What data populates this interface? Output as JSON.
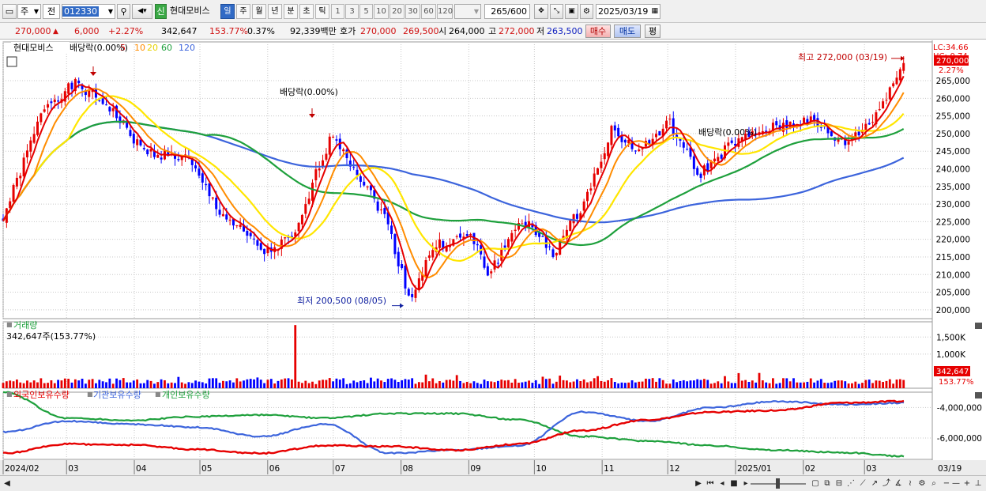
{
  "toolbar": {
    "market": "주",
    "jeon": "전",
    "code": "012330",
    "shin": "신",
    "name": "현대모비스",
    "periods": [
      "일",
      "주",
      "월",
      "년",
      "분",
      "초",
      "틱"
    ],
    "nums": [
      "1",
      "3",
      "5",
      "10",
      "20",
      "30",
      "60",
      "120"
    ],
    "count": "265",
    "count_total": "/600",
    "date": "2025/03/19"
  },
  "quote": {
    "price": "270,000",
    "change": "6,000",
    "change_pct": "+2.27%",
    "volume": "342,647",
    "volume_ratio": "153.77%",
    "turnover": "0.37%",
    "amount": "92,339백만",
    "hoga_label": "호가",
    "ask": "270,000",
    "bid": "269,500",
    "open_label": "시",
    "open": "264,000",
    "high_label": "고",
    "high": "272,000",
    "low_label": "저",
    "low": "263,500",
    "buy": "매수",
    "sell": "매도",
    "eval": "평"
  },
  "colors": {
    "up": "#e60000",
    "down": "#0000ff",
    "ma5": "#e60000",
    "ma10": "#ff8c00",
    "ma20": "#ffe600",
    "ma60": "#1ea03c",
    "ma120": "#3c64dc",
    "foreign": "#e60000",
    "inst": "#3c64dc",
    "indiv": "#1ea03c",
    "bg": "#ffffff",
    "grid": "#c8c8c8"
  },
  "chart_data": [
    {
      "type": "line",
      "title": "현대모비스",
      "ma_legend": [
        "5",
        "10",
        "20",
        "60",
        "120"
      ],
      "y_ticks": [
        "200,000",
        "205,000",
        "210,000",
        "215,000",
        "220,000",
        "225,000",
        "230,000",
        "235,000",
        "240,000",
        "245,000",
        "250,000",
        "255,000",
        "260,000",
        "265,000"
      ],
      "ylim": [
        197500,
        276000
      ],
      "corner_lc": "LC:34.66",
      "corner_hc": "HC:-0.74",
      "last_price": "270,000",
      "last_pct": "2.27%",
      "x_ticks": [
        "2024/02",
        "03",
        "04",
        "05",
        "06",
        "07",
        "08",
        "09",
        "10",
        "11",
        "12",
        "2025/01",
        "02",
        "03",
        "03/19"
      ],
      "key_points": [
        {
          "x": "2024/02/01",
          "close": 226000
        },
        {
          "x": "2024/02/20",
          "close": 258000
        },
        {
          "x": "2024/03/05",
          "close": 264000
        },
        {
          "x": "2024/03/20",
          "close": 258000
        },
        {
          "x": "2024/04/05",
          "close": 245000
        },
        {
          "x": "2024/04/25",
          "close": 243000
        },
        {
          "x": "2024/05/10",
          "close": 228000
        },
        {
          "x": "2024/05/31",
          "close": 216000
        },
        {
          "x": "2024/06/14",
          "close": 221000
        },
        {
          "x": "2024/06/25",
          "close": 242000
        },
        {
          "x": "2024/07/01",
          "close": 250000
        },
        {
          "x": "2024/07/15",
          "close": 236000
        },
        {
          "x": "2024/07/25",
          "close": 226000
        },
        {
          "x": "2024/08/05",
          "close": 203000
        },
        {
          "x": "2024/08/16",
          "close": 218000
        },
        {
          "x": "2024/09/02",
          "close": 221000
        },
        {
          "x": "2024/09/10",
          "close": 210000
        },
        {
          "x": "2024/09/25",
          "close": 226000
        },
        {
          "x": "2024/10/10",
          "close": 216000
        },
        {
          "x": "2024/10/25",
          "close": 232000
        },
        {
          "x": "2024/11/05",
          "close": 251000
        },
        {
          "x": "2024/11/18",
          "close": 245000
        },
        {
          "x": "2024/12/02",
          "close": 253000
        },
        {
          "x": "2024/12/15",
          "close": 238000
        },
        {
          "x": "2024/12/30",
          "close": 247000
        },
        {
          "x": "2025/01/15",
          "close": 251000
        },
        {
          "x": "2025/02/03",
          "close": 254000
        },
        {
          "x": "2025/02/20",
          "close": 247000
        },
        {
          "x": "2025/03/05",
          "close": 254000
        },
        {
          "x": "2025/03/19",
          "close": 270000
        }
      ],
      "annotations": [
        {
          "text": "최고 272,000 (03/19)",
          "x": "2025/03/19",
          "y": 272000,
          "color": "red"
        },
        {
          "text": "최저 200,500 (08/05)",
          "x": "2024/08/05",
          "y": 200500,
          "color": "blue"
        },
        {
          "text": "배당락(0.00%)",
          "x": "2024/03/04",
          "y": 267000
        },
        {
          "text": "배당락(0.00%)",
          "x": "2024/06/27",
          "y": 254000
        },
        {
          "text": "배당락(0.00%)",
          "x": "2024/12/27",
          "y": 250000
        }
      ]
    },
    {
      "type": "bar",
      "title": "거래량",
      "current_label": "342,647주(153.77%)",
      "y_ticks": [
        "1,000K",
        "1,500K"
      ],
      "ylim": [
        0,
        1900000
      ],
      "last_value": "342,647",
      "last_pct": "153.77%",
      "spike": {
        "x": "2024/06/14",
        "value": 1850000
      }
    },
    {
      "type": "line",
      "series": [
        {
          "name": "외국인보유수량"
        },
        {
          "name": "기관보유수량"
        },
        {
          "name": "개인보유수량"
        }
      ],
      "y_ticks": [
        "-4,000,000",
        "-6,000,000"
      ],
      "ylim": [
        -7400000,
        -3000000
      ],
      "foreign": [
        -7000000,
        -6400000,
        -6450000,
        -6750000,
        -7000000,
        -6500000,
        -6550000,
        -6800000,
        -6400000,
        -5500000,
        -4800000,
        -4300000,
        -4200000,
        -3700000,
        -3600000
      ],
      "inst": [
        -5600000,
        -4900000,
        -5100000,
        -5300000,
        -5900000,
        -5100000,
        -7000000,
        -6800000,
        -6500000,
        -4300000,
        -4900000,
        -4000000,
        -3600000,
        -3800000,
        -3700000
      ],
      "indiv": [
        -3000000,
        -4700000,
        -4850000,
        -4600000,
        -4500000,
        -4700000,
        -4400000,
        -4400000,
        -4800000,
        -5900000,
        -6200000,
        -6500000,
        -6800000,
        -6950000,
        -7200000
      ]
    }
  ]
}
